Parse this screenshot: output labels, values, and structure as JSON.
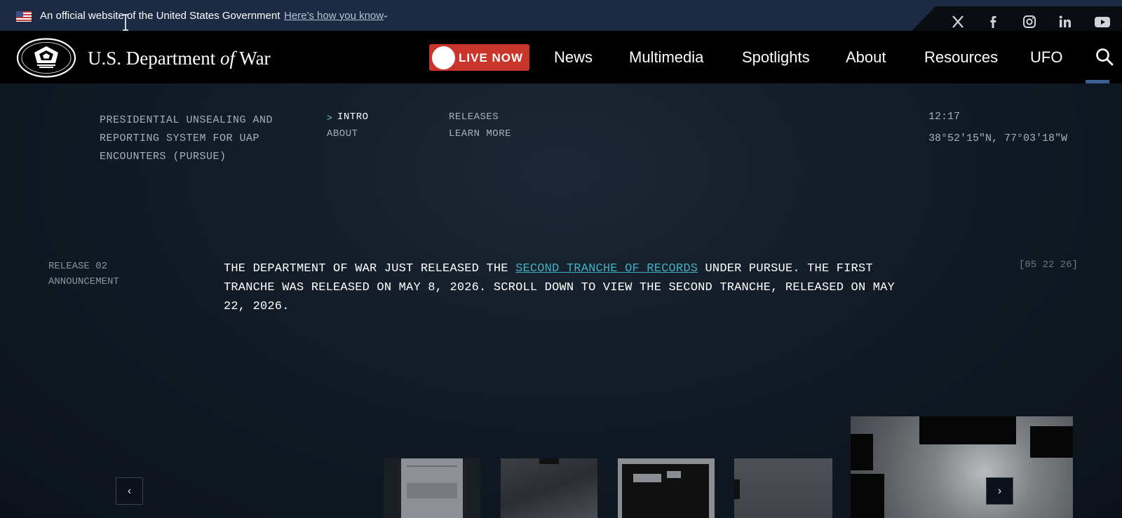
{
  "gov_banner": {
    "text": "An official website of the United States Government",
    "link": "Here's how you know"
  },
  "social": [
    "x-icon",
    "facebook-icon",
    "instagram-icon",
    "linkedin-icon",
    "youtube-icon"
  ],
  "header": {
    "title_pre": "U.S. Department",
    "title_of": "of",
    "title_post": "War",
    "live_label": "LIVE NOW",
    "nav": [
      "News",
      "Multimedia",
      "Spotlights",
      "About",
      "Resources",
      "UFO"
    ]
  },
  "hero": {
    "title": "PRESIDENTIAL UNSEALING AND REPORTING SYSTEM FOR UAP ENCOUNTERS (PURSUE)",
    "subnav": {
      "intro": "INTRO",
      "about": "ABOUT",
      "releases": "RELEASES",
      "learn_more": "LEARN MORE"
    },
    "time": "12:17",
    "coords": "38°52′15″N, 77°03′18″W",
    "release_number": "RELEASE 02",
    "release_type": "ANNOUNCEMENT",
    "announcement_pre": "THE DEPARTMENT OF WAR JUST RELEASED THE ",
    "announcement_link": "SECOND TRANCHE OF RECORDS",
    "announcement_post": " UNDER PURSUE. THE FIRST TRANCHE WAS RELEASED ON MAY 8, 2026. SCROLL DOWN TO VIEW THE SECOND TRANCHE, RELEASED ON MAY 22, 2026.",
    "release_date": "[05 22 26]"
  },
  "carousel": {
    "prev_icon": "chevron-left-icon",
    "next_icon": "chevron-right-icon",
    "prev": "‹",
    "next": "›"
  },
  "colors": {
    "gov_banner": "#1b2b44",
    "header": "#000000",
    "live": "#c9342b",
    "link": "#3fb1c2",
    "accent_underline": "#3b5e95"
  }
}
